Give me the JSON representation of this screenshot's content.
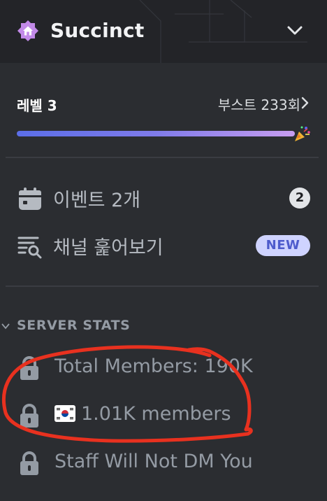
{
  "header": {
    "server_name": "Succinct",
    "icon": "home-icon",
    "dropdown_icon": "chevron-down-icon",
    "icon_color": "#c28ae8"
  },
  "boost": {
    "level_label": "레벨 3",
    "count_label": "부스트 233회",
    "progress": 1.0,
    "party_icon": "party-popper-icon"
  },
  "menu": {
    "events": {
      "label": "이벤트 2개",
      "count": "2",
      "icon": "calendar-icon"
    },
    "browse": {
      "label": "채널 훑어보기",
      "badge": "NEW",
      "icon": "browse-channels-icon"
    }
  },
  "server_stats": {
    "title": "SERVER STATS",
    "channels": [
      {
        "label": "Total Members: 190K",
        "icon": "lock-icon"
      },
      {
        "label": "1.01K members",
        "icon": "lock-icon",
        "flag": "south-korea-flag-icon"
      },
      {
        "label": "Staff Will Not DM You",
        "icon": "lock-icon"
      }
    ]
  },
  "annotation": {
    "color": "#e8311f"
  }
}
